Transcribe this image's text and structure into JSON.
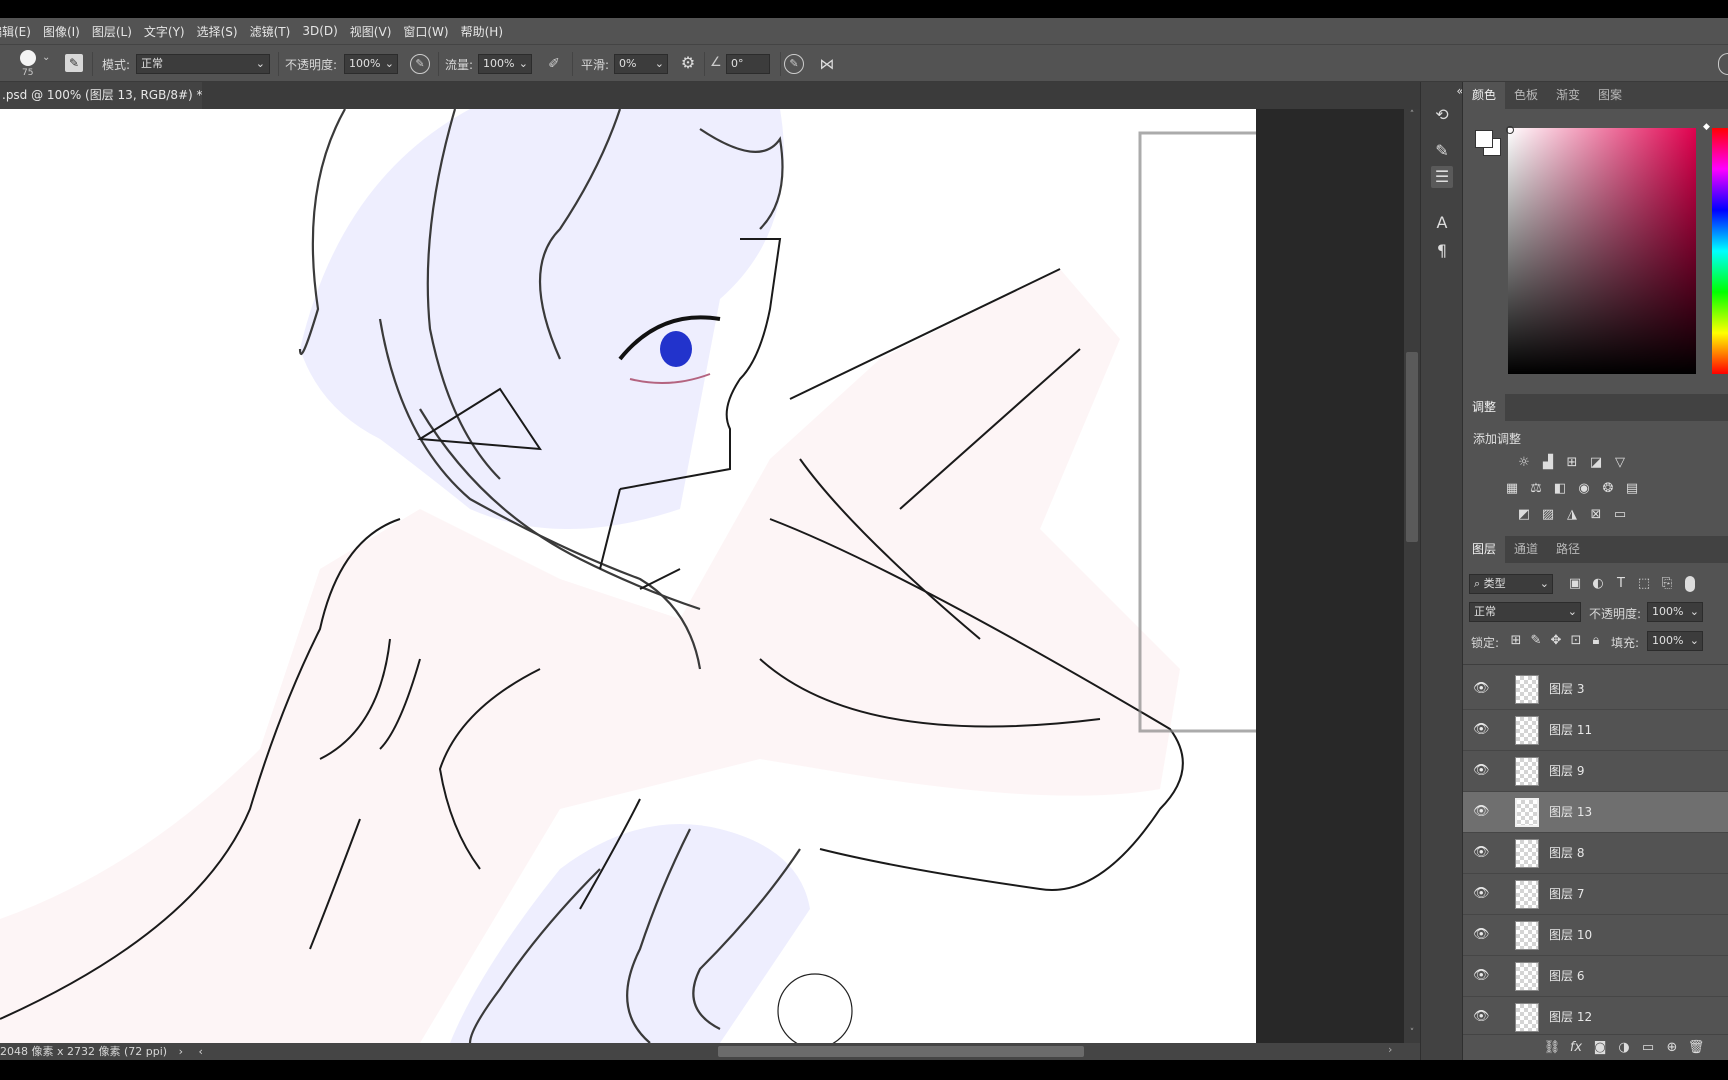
{
  "menubar": {
    "items": [
      "编辑(E)",
      "图像(I)",
      "图层(L)",
      "文字(Y)",
      "选择(S)",
      "滤镜(T)",
      "3D(D)",
      "视图(V)",
      "窗口(W)",
      "帮助(H)"
    ]
  },
  "options": {
    "brush_size": "75",
    "mode_label": "模式:",
    "mode_value": "正常",
    "opacity_label": "不透明度:",
    "opacity_value": "100%",
    "flow_label": "流量:",
    "flow_value": "100%",
    "smoothing_label": "平滑:",
    "smoothing_value": "0%",
    "angle_value": "0°"
  },
  "document": {
    "tab_title": ".psd @ 100% (图层 13, RGB/8#) *",
    "status": "2048 像素 x 2732 像素 (72 ppi)"
  },
  "color_panel": {
    "tabs": [
      "颜色",
      "色板",
      "渐变",
      "图案"
    ],
    "active_tab": "颜色",
    "foreground": "#ffffff",
    "background": "#ffffff",
    "hue_color": "#e0004e"
  },
  "adjustments": {
    "title": "调整",
    "add_label": "添加调整"
  },
  "layers_panel": {
    "tabs": [
      "图层",
      "通道",
      "路径"
    ],
    "active_tab": "图层",
    "filter_label": "类型",
    "blend_mode": "正常",
    "opacity_label": "不透明度:",
    "opacity_value": "100%",
    "lock_label": "锁定:",
    "fill_label": "填充:",
    "fill_value": "100%",
    "layers": [
      {
        "name": "图层 3",
        "selected": false
      },
      {
        "name": "图层 11",
        "selected": false
      },
      {
        "name": "图层 9",
        "selected": false
      },
      {
        "name": "图层 13",
        "selected": true
      },
      {
        "name": "图层 8",
        "selected": false
      },
      {
        "name": "图层 7",
        "selected": false
      },
      {
        "name": "图层 10",
        "selected": false
      },
      {
        "name": "图层 6",
        "selected": false
      },
      {
        "name": "图层 12",
        "selected": false
      }
    ]
  },
  "icons": {
    "eye": "eye-icon",
    "close": "close-icon",
    "gear": "gear-icon"
  }
}
